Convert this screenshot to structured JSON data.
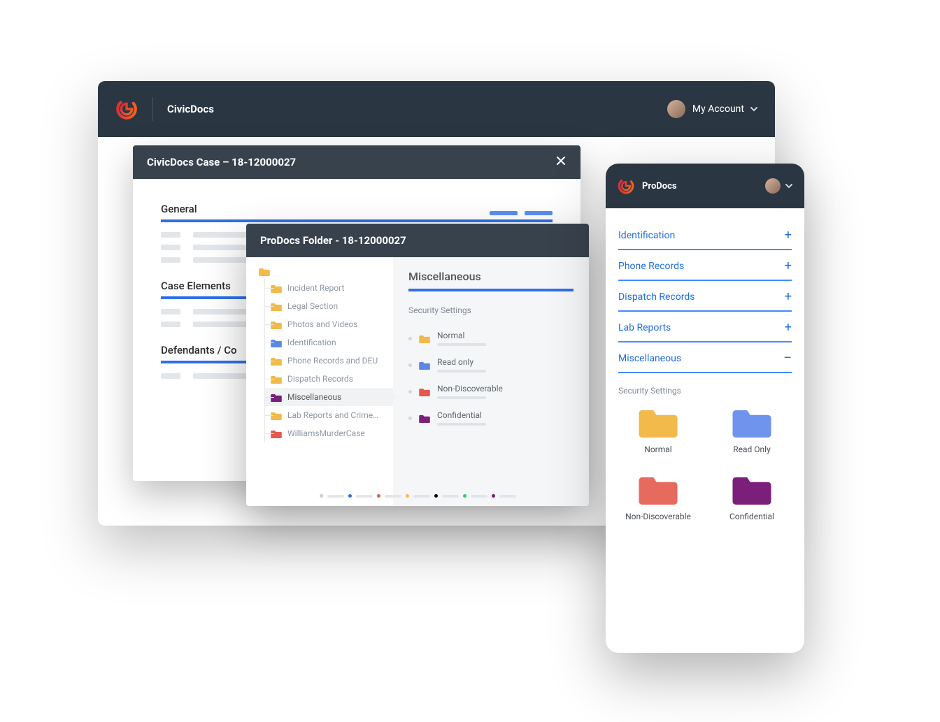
{
  "colors": {
    "header_bg": "#2a3642",
    "modal_header_bg": "#38424d",
    "accent_blue": "#2f6fe8",
    "folder_yellow": "#f2b94b",
    "folder_blue": "#5b87e8",
    "folder_red": "#e25a4e",
    "folder_purple": "#7a1f7a",
    "folder_green": "#2ecc71",
    "folder_black": "#000000",
    "text_muted": "#8f98a3"
  },
  "desktop": {
    "app_name": "CivicDocs",
    "account_label": "My  Account"
  },
  "case_modal": {
    "title": "CivicDocs Case – 18-12000027",
    "sections": [
      "General",
      "Case Elements",
      "Defendants / Co"
    ]
  },
  "folder_modal": {
    "title": "ProDocs Folder - 18-12000027",
    "tree": [
      {
        "label": "Incident Report",
        "color": "#f2b94b"
      },
      {
        "label": "Legal Section",
        "color": "#f2b94b"
      },
      {
        "label": "Photos and Videos",
        "color": "#f2b94b"
      },
      {
        "label": "Identification",
        "color": "#5b87e8"
      },
      {
        "label": "Phone Records and DEU",
        "color": "#f2b94b"
      },
      {
        "label": "Dispatch Records",
        "color": "#f2b94b"
      },
      {
        "label": "Miscellaneous",
        "color": "#7a1f7a",
        "selected": true
      },
      {
        "label": "Lab Reports and Crime…",
        "color": "#f2b94b"
      },
      {
        "label": "WilliamsMurderCase",
        "color": "#e25a4e"
      }
    ],
    "detail": {
      "title": "Miscellaneous",
      "subtitle": "Security Settings",
      "items": [
        {
          "label": "Normal",
          "color": "#f2b94b"
        },
        {
          "label": "Read only",
          "color": "#5b87e8"
        },
        {
          "label": "Non-Discoverable",
          "color": "#e25a4e"
        },
        {
          "label": "Confidential",
          "color": "#7a1f7a"
        }
      ]
    },
    "pager_colors": [
      "#c9cdd2",
      "#2f6fe8",
      "#e25a4e",
      "#f2b94b",
      "#000000",
      "#2ecc71",
      "#7a1f7a"
    ]
  },
  "mobile": {
    "app_name": "ProDocs",
    "accordion": [
      {
        "label": "Identification",
        "expanded": false
      },
      {
        "label": "Phone Records",
        "expanded": false
      },
      {
        "label": "Dispatch Records",
        "expanded": false
      },
      {
        "label": "Lab Reports",
        "expanded": false
      },
      {
        "label": "Miscellaneous",
        "expanded": true
      }
    ],
    "security_subtitle": "Security Settings",
    "security": [
      {
        "label": "Normal",
        "color": "#f2b94b"
      },
      {
        "label": "Read Only",
        "color": "#6f94ee"
      },
      {
        "label": "Non-Discoverable",
        "color": "#e76a5e"
      },
      {
        "label": "Confidential",
        "color": "#7a1f7a"
      }
    ]
  }
}
